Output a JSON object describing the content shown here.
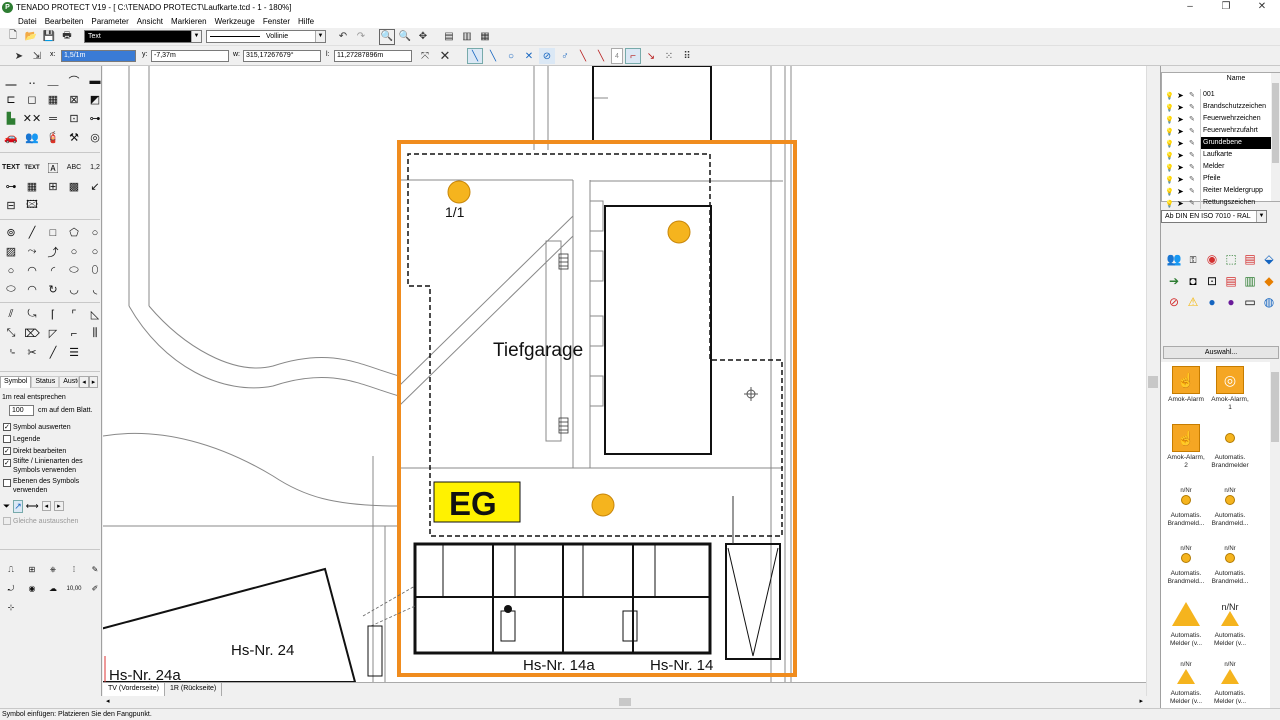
{
  "window": {
    "title": "TENADO PROTECT V19 - [ C:\\TENADO PROTECT\\Laufkarte.tcd - 1 - 180%]",
    "app_icon": "tenado-app-icon"
  },
  "menu": [
    "Datei",
    "Bearbeiten",
    "Parameter",
    "Ansicht",
    "Markieren",
    "Werkzeuge",
    "Fenster",
    "Hilfe"
  ],
  "toolbar": {
    "text_style": "Text",
    "line_style": "Vollinie"
  },
  "coords": {
    "x_label": "x:",
    "x_value": "1,5/1m",
    "y_label": "y:",
    "y_value": "-7,37m",
    "w_label": "w:",
    "w_value": "315,17267679°",
    "l_label": "l:",
    "l_value": "11,27287896m"
  },
  "left_panel": {
    "tabs": [
      "Symbol",
      "Status",
      "Auste"
    ],
    "scale_label": "1m real entsprechen",
    "scale_value": "100",
    "scale_unit": "cm auf dem Blatt.",
    "options": [
      {
        "label": "Symbol auswerten",
        "checked": true
      },
      {
        "label": "Legende",
        "checked": false
      },
      {
        "label": "Direkt bearbeiten",
        "checked": true
      },
      {
        "label": "Stifte / Linienarten des Symbols verwenden",
        "checked": true
      },
      {
        "label": "Ebenen des Symbols verwenden",
        "checked": false
      }
    ],
    "replace_label": "Gleiche austauschen"
  },
  "canvas": {
    "labels": {
      "tiefgarage": "Tiefgarage",
      "eg": "EG",
      "room": "1/1",
      "hs24": "Hs-Nr. 24",
      "hs24a": "Hs-Nr. 24a",
      "hs14a": "Hs-Nr. 14a",
      "hs14": "Hs-Nr. 14"
    }
  },
  "sheet_tabs": [
    "TV (Vorderseite)",
    "1R (Rückseite)"
  ],
  "status": "Symbol einfügen: Platzieren Sie den Fangpunkt.",
  "layers": {
    "header": "Name",
    "items": [
      {
        "name": "001",
        "selected": false
      },
      {
        "name": "Brandschutzzeichen",
        "selected": false
      },
      {
        "name": "Feuerwehrzeichen",
        "selected": false
      },
      {
        "name": "Feuerwehrzufahrt",
        "selected": false
      },
      {
        "name": "Grundebene",
        "selected": true
      },
      {
        "name": "Laufkarte",
        "selected": false
      },
      {
        "name": "Melder",
        "selected": false
      },
      {
        "name": "Pfeile",
        "selected": false
      },
      {
        "name": "Reiter Meldergrupp",
        "selected": false
      },
      {
        "name": "Rettungszeichen",
        "selected": false
      }
    ]
  },
  "catalog": "Ab DIN EN ISO 7010 - RAL",
  "select_button": "Auswahl...",
  "symbols": [
    {
      "label": "Amok-Alarm",
      "badge": ""
    },
    {
      "label": "Amok-Alarm, 1",
      "badge": ""
    },
    {
      "label": "Amok-Alarm, 2",
      "badge": ""
    },
    {
      "label": "Automatis. Brandmelder",
      "badge": ""
    },
    {
      "label": "Automatis. Brandmeld...",
      "badge": "n/Nr"
    },
    {
      "label": "Automatis. Brandmeld...",
      "badge": "n/Nr"
    },
    {
      "label": "Automatis. Brandmeld...",
      "badge": "n/Nr"
    },
    {
      "label": "Automatis. Brandmeld...",
      "badge": "n/Nr"
    },
    {
      "label": "Automatis. Melder (v...",
      "badge": ""
    },
    {
      "label": "Automatis. Melder (v...",
      "badge": "n/Nr"
    },
    {
      "label": "Automatis. Melder (v...",
      "badge": "n/Nr"
    },
    {
      "label": "Automatis. Melder (v...",
      "badge": "n/Nr"
    }
  ],
  "colors": {
    "orange_border": "#f08c1e",
    "yellow_marker": "#f5b41e",
    "eg_fill": "#fff200",
    "selection": "#000000"
  }
}
